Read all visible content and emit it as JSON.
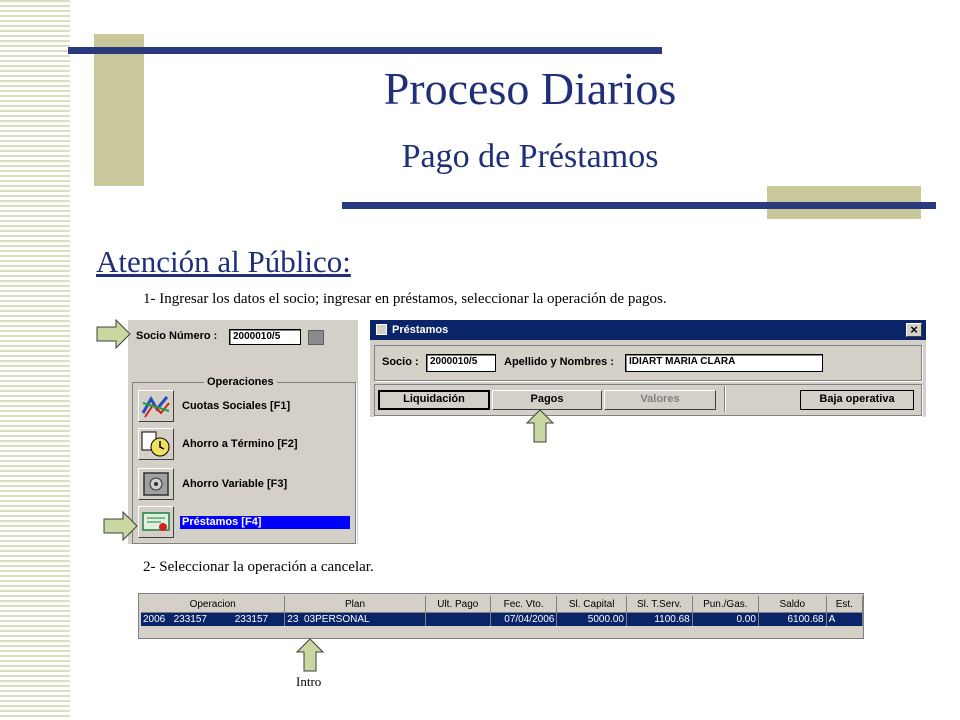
{
  "slide": {
    "title": "Proceso Diarios",
    "subtitle": "Pago de Préstamos",
    "section_heading": "Atención  al Público:",
    "step1": "1- Ingresar los datos el socio; ingresar en préstamos, seleccionar la operación de pagos.",
    "step2": "2- Seleccionar la operación a cancelar.",
    "intro_label": "Intro"
  },
  "left_panel": {
    "socio_label": "Socio Número :",
    "socio_value": "2000010/5",
    "group_title": "Operaciones",
    "items": [
      {
        "label": "Cuotas Sociales [F1]",
        "icon": "cuotas-icon"
      },
      {
        "label": "Ahorro a Término [F2]",
        "icon": "clock-icon"
      },
      {
        "label": "Ahorro Variable [F3]",
        "icon": "safe-icon"
      },
      {
        "label": "Préstamos [F4]",
        "icon": "certificate-icon",
        "selected": true
      }
    ]
  },
  "prestamos_window": {
    "title": "Préstamos",
    "close_glyph": "×",
    "socio_label": "Socio :",
    "socio_value": "2000010/5",
    "nombre_label": "Apellido y Nombres :",
    "nombre_value": "IDIART MARIA CLARA",
    "buttons": {
      "liquidacion": "Liquidación",
      "pagos": "Pagos",
      "valores": "Valores",
      "baja": "Baja operativa"
    }
  },
  "grid": {
    "headers": [
      "Operacion",
      "Plan",
      "Ult. Pago",
      "Fec. Vto.",
      "Sl. Capital",
      "Sl. T.Serv.",
      "Pun./Gas.",
      "Saldo",
      "Est."
    ],
    "row": [
      "2006   233157          233157",
      "23  03PERSONAL",
      "",
      "07/04/2006",
      "5000.00",
      "1100.68",
      "0.00",
      "6100.68",
      "A"
    ]
  },
  "colors": {
    "title": "#1f2f7a",
    "selection": "#0a246a",
    "arrow_fill": "#c8d8a0",
    "window_title": "#0a246a"
  }
}
